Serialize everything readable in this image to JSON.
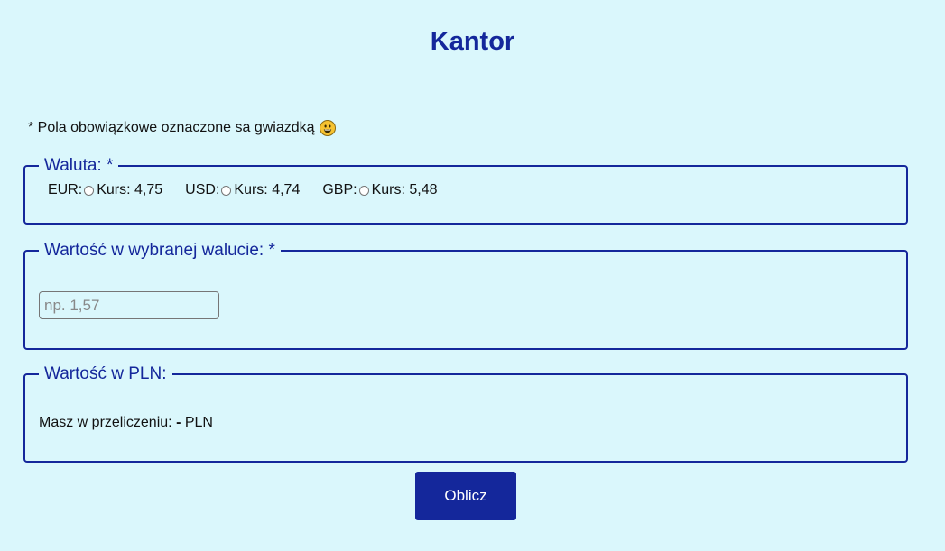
{
  "header": {
    "title": "Kantor"
  },
  "note": {
    "text": "* Pola obowiązkowe oznaczone sa gwiazdką",
    "icon": "grinning-face-icon"
  },
  "currency_section": {
    "legend": "Waluta: *",
    "options": [
      {
        "code": "EUR:",
        "rate_label": "Kurs: 4,75"
      },
      {
        "code": "USD:",
        "rate_label": "Kurs: 4,74"
      },
      {
        "code": "GBP:",
        "rate_label": "Kurs: 5,48"
      }
    ]
  },
  "amount_section": {
    "legend": "Wartość w wybranej walucie: *",
    "input_value": "",
    "input_placeholder": "np. 1,57"
  },
  "result_section": {
    "legend": "Wartość w PLN:",
    "label": "Masz w przeliczeniu:",
    "value": "-",
    "unit": "PLN"
  },
  "actions": {
    "submit_label": "Oblicz"
  },
  "colors": {
    "background": "#daf7fc",
    "accent": "#14279b"
  }
}
